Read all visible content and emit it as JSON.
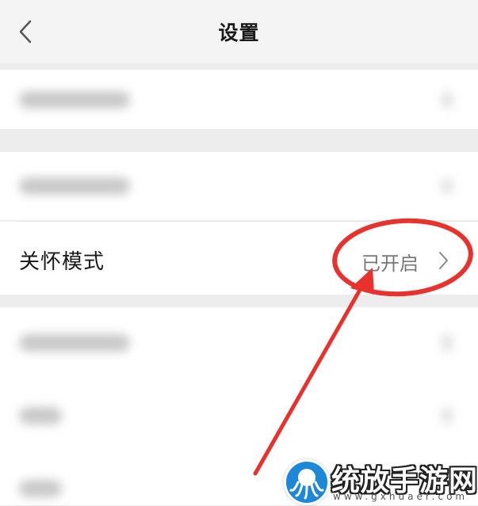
{
  "nav": {
    "title": "设置"
  },
  "care_mode": {
    "label": "关怀模式",
    "value": "已开启"
  },
  "watermark": {
    "name": "统放手游网",
    "url": "www.gxhuaer.com"
  },
  "colors": {
    "annotation_red": "#e8322d",
    "background": "#ededed",
    "row": "#ffffff",
    "watermark_blue": "#1e88d8"
  },
  "icons": {
    "back": "chevron-left-icon",
    "row_arrow": "chevron-right-icon",
    "watermark_logo": "octopus-logo-icon"
  }
}
